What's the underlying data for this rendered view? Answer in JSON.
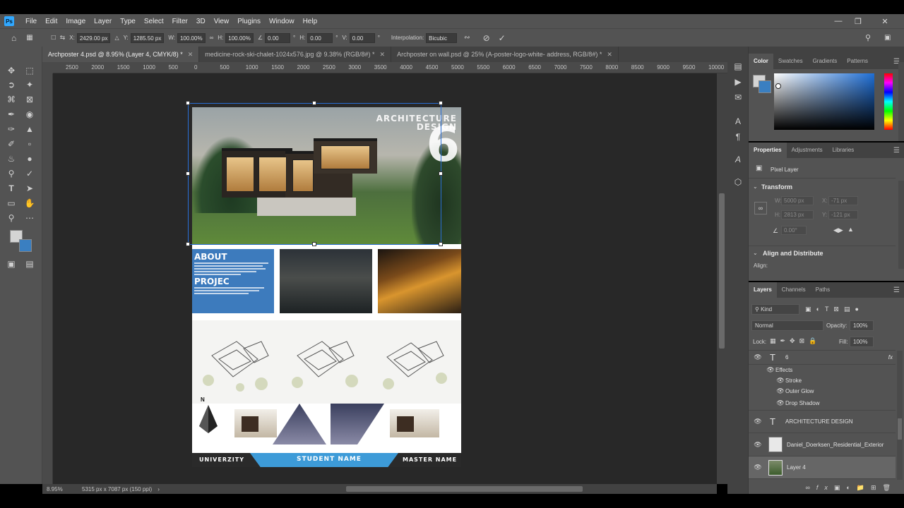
{
  "app": {
    "logo_text": "Ps"
  },
  "menu": [
    "File",
    "Edit",
    "Image",
    "Layer",
    "Type",
    "Select",
    "Filter",
    "3D",
    "View",
    "Plugins",
    "Window",
    "Help"
  ],
  "options": {
    "x_label": "X:",
    "x_value": "2429.00 px",
    "y_label": "Y:",
    "y_value": "1285.50 px",
    "w_label": "W:",
    "w_value": "100.00%",
    "h_label": "H:",
    "h_value": "100.00%",
    "angle_value": "0.00",
    "deg": "°",
    "hskew_label": "H:",
    "hskew_value": "0.00",
    "vskew_label": "V:",
    "vskew_value": "0.00",
    "interp_label": "Interpolation:",
    "interp_value": "Bicubic"
  },
  "tabs": [
    {
      "label": "Archposter 4.psd @ 8.95% (Layer 4, CMYK/8) *",
      "active": true
    },
    {
      "label": "medicine-rock-ski-chalet-1024x576.jpg @ 9.38% (RGB/8#) *",
      "active": false
    },
    {
      "label": "Archposter on wall.psd @ 25% (A-poster-logo-white- address, RGB/8#) *",
      "active": false
    }
  ],
  "ruler_ticks": [
    "2500",
    "2000",
    "1500",
    "1000",
    "500",
    "0",
    "500",
    "1000",
    "1500",
    "2000",
    "2500",
    "3000",
    "3500",
    "4000",
    "4500",
    "5000",
    "5500",
    "6000",
    "6500",
    "7000",
    "7500",
    "8000",
    "8500",
    "9000",
    "9500",
    "10000"
  ],
  "status": {
    "zoom": "8.95%",
    "doc": "5315 px x 7087 px (150 ppi)"
  },
  "color_panel": {
    "tabs": [
      "Color",
      "Swatches",
      "Gradients",
      "Patterns"
    ],
    "fg": "#d4d4d4",
    "bg": "#3a7fc1"
  },
  "properties": {
    "tabs": [
      "Properties",
      "Adjustments",
      "Libraries"
    ],
    "kind": "Pixel Layer",
    "transform_title": "Transform",
    "w": "5000 px",
    "x": "-71 px",
    "h": "2813 px",
    "y": "-121 px",
    "angle": "0.00°",
    "align_title": "Align and Distribute",
    "align_label": "Align:"
  },
  "layers": {
    "tabs": [
      "Layers",
      "Channels",
      "Paths"
    ],
    "kind_label": "Kind",
    "blend": "Normal",
    "opacity_label": "Opacity:",
    "opacity": "100%",
    "lock_label": "Lock:",
    "fill_label": "Fill:",
    "fill": "100%",
    "rows": [
      {
        "name": "6",
        "type": "text",
        "fx": "fx"
      },
      {
        "name": "Effects",
        "type": "effects"
      },
      {
        "name": "Stroke",
        "type": "effect"
      },
      {
        "name": "Outer Glow",
        "type": "effect"
      },
      {
        "name": "Drop Shadow",
        "type": "effect"
      },
      {
        "name": "ARCHITECTURE DESIGN",
        "type": "text"
      },
      {
        "name": "Daniel_Doerksen_Residential_Exterior",
        "type": "smart"
      },
      {
        "name": "Layer 4",
        "type": "pixel",
        "selected": true
      }
    ]
  },
  "poster": {
    "hero_title": "ARCHITECTURE",
    "hero_sub": "DESIGN",
    "hero_number": "6",
    "about": "ABOUT",
    "project": "PROJEC",
    "north": "N",
    "university": "UNIVERZITY",
    "student": "STUDENT NAME",
    "master": "MASTER NAME"
  }
}
